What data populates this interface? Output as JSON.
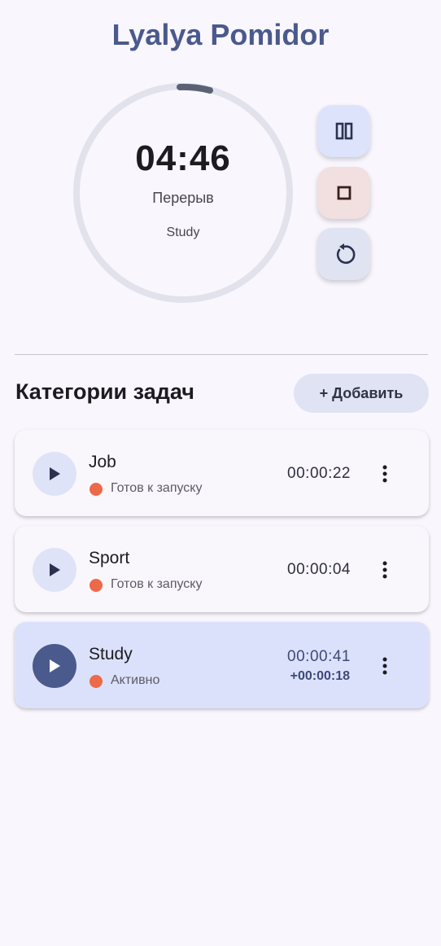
{
  "app": {
    "title": "Lyalya Pomidor"
  },
  "timer": {
    "time": "04:46",
    "phase": "Перерыв",
    "category": "Study",
    "progress_fraction": 0.05
  },
  "controls": {
    "pause_icon": "pause-icon",
    "stop_icon": "stop-icon",
    "reset_icon": "reset-icon"
  },
  "categories_section": {
    "title": "Категории задач",
    "add_label": "+ Добавить"
  },
  "categories": [
    {
      "name": "Job",
      "status": "Готов к запуску",
      "time": "00:00:22",
      "extra": "",
      "active": false
    },
    {
      "name": "Sport",
      "status": "Готов к запуску",
      "time": "00:00:04",
      "extra": "",
      "active": false
    },
    {
      "name": "Study",
      "status": "Активно",
      "time": "00:00:41",
      "extra": "+00:00:18",
      "active": true
    }
  ],
  "colors": {
    "accent": "#4a5a8c",
    "status_dot": "#ec6a4a",
    "ring_track": "#e1e2eb",
    "ring_progress": "#5b6275"
  }
}
